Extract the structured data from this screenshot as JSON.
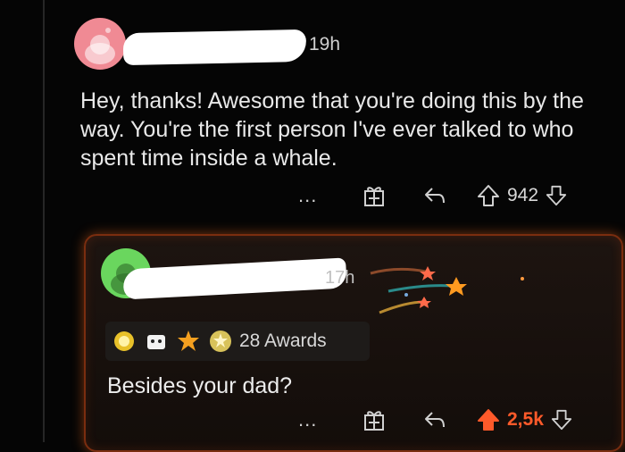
{
  "comment": {
    "time": "19h",
    "text": "Hey, thanks! Awesome that you're doing this by the way. You're the first person I've ever talked to who spent time inside a whale.",
    "more": "...",
    "score": "942"
  },
  "reply": {
    "time": "17h",
    "awards_label": "28 Awards",
    "text": "Besides your dad?",
    "more": "...",
    "score": "2,5k"
  },
  "colors": {
    "upvoted": "#ff5a2a",
    "card_glow": "#ff6e1e",
    "avatar_pink": "#f08a94",
    "avatar_green": "#6ad65e"
  }
}
